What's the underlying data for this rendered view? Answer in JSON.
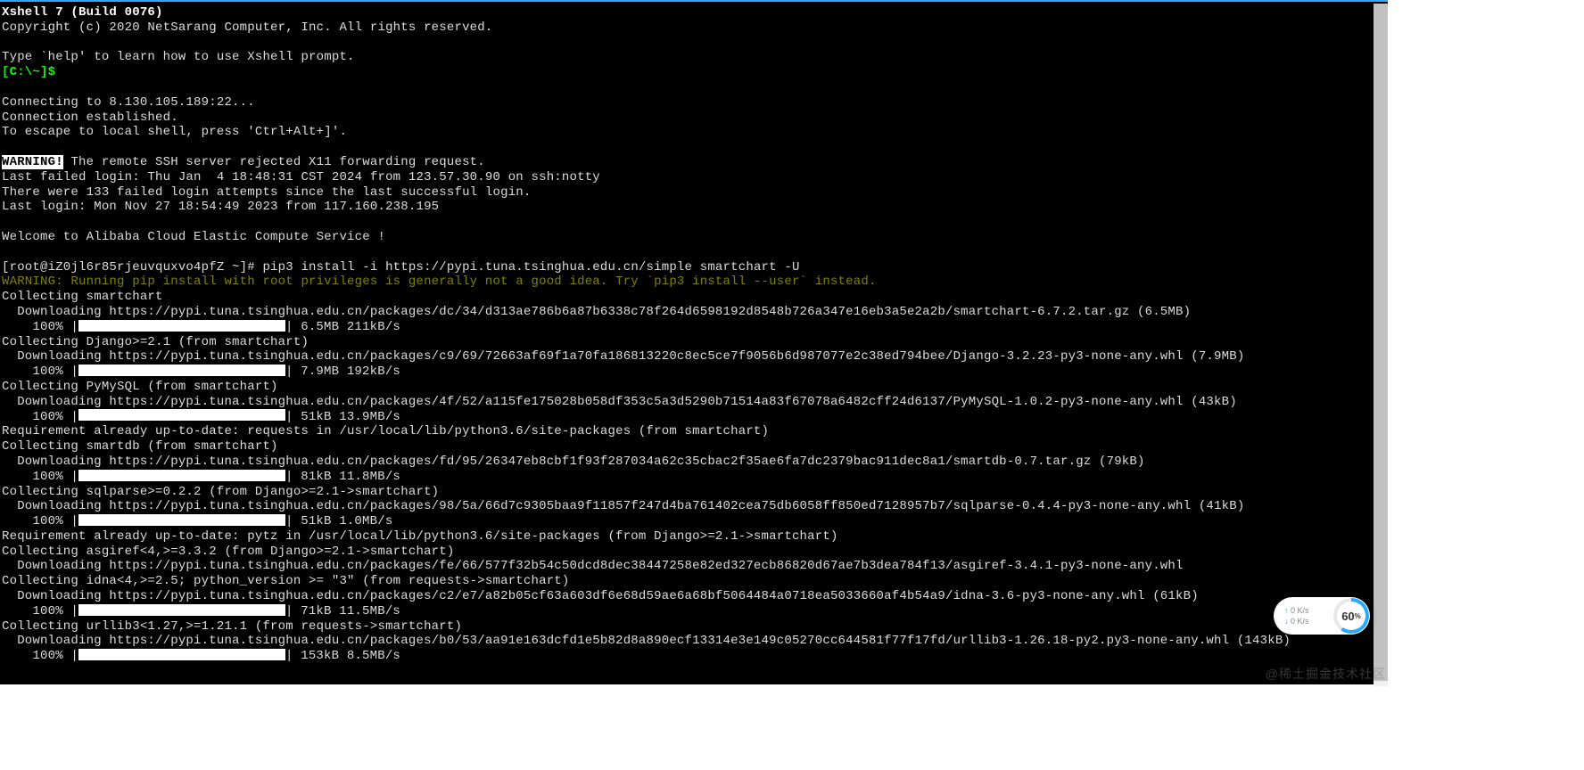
{
  "header": {
    "title": "Xshell 7 (Build 0076)",
    "copyright": "Copyright (c) 2020 NetSarang Computer, Inc. All rights reserved.",
    "help_hint": "Type `help' to learn how to use Xshell prompt.",
    "local_prompt": "[C:\\~]$"
  },
  "conn": {
    "connecting": "Connecting to 8.130.105.189:22...",
    "established": "Connection established.",
    "escape": "To escape to local shell, press 'Ctrl+Alt+]'."
  },
  "warn": {
    "label": "WARNING!",
    "x11": " The remote SSH server rejected X11 forwarding request.",
    "last_failed": "Last failed login: Thu Jan  4 18:48:31 CST 2024 from 123.57.30.90 on ssh:notty",
    "failed_count": "There were 133 failed login attempts since the last successful login.",
    "last_login": "Last login: Mon Nov 27 18:54:49 2023 from 117.160.238.195"
  },
  "welcome": "Welcome to Alibaba Cloud Elastic Compute Service !",
  "shell": {
    "prompt": "[root@iZ0jl6r85rjeuvquxvo4pfZ ~]# ",
    "command": "pip3 install -i https://pypi.tuna.tsinghua.edu.cn/simple smartchart -U",
    "pip_warn": "WARNING: Running pip install with root privileges is generally not a good idea. Try `pip3 install --user` instead."
  },
  "pkg": [
    {
      "collect": "Collecting smartchart",
      "dl": "  Downloading https://pypi.tuna.tsinghua.edu.cn/packages/dc/34/d313ae786b6a87b6338c78f264d6598192d8548b726a347e16eb3a5e2a2b/smartchart-6.7.2.tar.gz (6.5MB)",
      "pct": "    100% |",
      "stats": "| 6.5MB 211kB/s"
    },
    {
      "collect": "Collecting Django>=2.1 (from smartchart)",
      "dl": "  Downloading https://pypi.tuna.tsinghua.edu.cn/packages/c9/69/72663af69f1a70fa186813220c8ec5ce7f9056b6d987077e2c38ed794bee/Django-3.2.23-py3-none-any.whl (7.9MB)",
      "pct": "    100% |",
      "stats": "| 7.9MB 192kB/s"
    },
    {
      "collect": "Collecting PyMySQL (from smartchart)",
      "dl": "  Downloading https://pypi.tuna.tsinghua.edu.cn/packages/4f/52/a115fe175028b058df353c5a3d5290b71514a83f67078a6482cff24d6137/PyMySQL-1.0.2-py3-none-any.whl (43kB)",
      "pct": "    100% |",
      "stats": "| 51kB 13.9MB/s"
    }
  ],
  "req1": "Requirement already up-to-date: requests in /usr/local/lib/python3.6/site-packages (from smartchart)",
  "pkg2": [
    {
      "collect": "Collecting smartdb (from smartchart)",
      "dl": "  Downloading https://pypi.tuna.tsinghua.edu.cn/packages/fd/95/26347eb8cbf1f93f287034a62c35cbac2f35ae6fa7dc2379bac911dec8a1/smartdb-0.7.tar.gz (79kB)",
      "pct": "    100% |",
      "stats": "| 81kB 11.8MB/s"
    },
    {
      "collect": "Collecting sqlparse>=0.2.2 (from Django>=2.1->smartchart)",
      "dl": "  Downloading https://pypi.tuna.tsinghua.edu.cn/packages/98/5a/66d7c9305baa9f11857f247d4ba761402cea75db6058ff850ed7128957b7/sqlparse-0.4.4-py3-none-any.whl (41kB)",
      "pct": "    100% |",
      "stats": "| 51kB 1.0MB/s"
    }
  ],
  "req2": "Requirement already up-to-date: pytz in /usr/local/lib/python3.6/site-packages (from Django>=2.1->smartchart)",
  "pkg3": [
    {
      "collect": "Collecting asgiref<4,>=3.3.2 (from Django>=2.1->smartchart)",
      "dl": "  Downloading https://pypi.tuna.tsinghua.edu.cn/packages/fe/66/577f32b54c50dcd8dec38447258e82ed327ecb86820d67ae7b3dea784f13/asgiref-3.4.1-py3-none-any.whl"
    },
    {
      "collect": "Collecting idna<4,>=2.5; python_version >= \"3\" (from requests->smartchart)",
      "dl": "  Downloading https://pypi.tuna.tsinghua.edu.cn/packages/c2/e7/a82b05cf63a603df6e68d59ae6a68bf5064484a0718ea5033660af4b54a9/idna-3.6-py3-none-any.whl (61kB)",
      "pct": "    100% |",
      "stats": "| 71kB 11.5MB/s"
    },
    {
      "collect": "Collecting urllib3<1.27,>=1.21.1 (from requests->smartchart)",
      "dl": "  Downloading https://pypi.tuna.tsinghua.edu.cn/packages/b0/53/aa91e163dcfd1e5b82d8a890ecf13314e3e149c05270cc644581f77f17fd/urllib3-1.26.18-py2.py3-none-any.whl (143kB)",
      "pct": "    100% |",
      "stats": "| 153kB 8.5MB/s"
    }
  ],
  "widget": {
    "up": "0  K/s",
    "down": "0  K/s",
    "pct": "60",
    "pct_suffix": "%"
  },
  "watermark": "@稀土掘金技术社区"
}
